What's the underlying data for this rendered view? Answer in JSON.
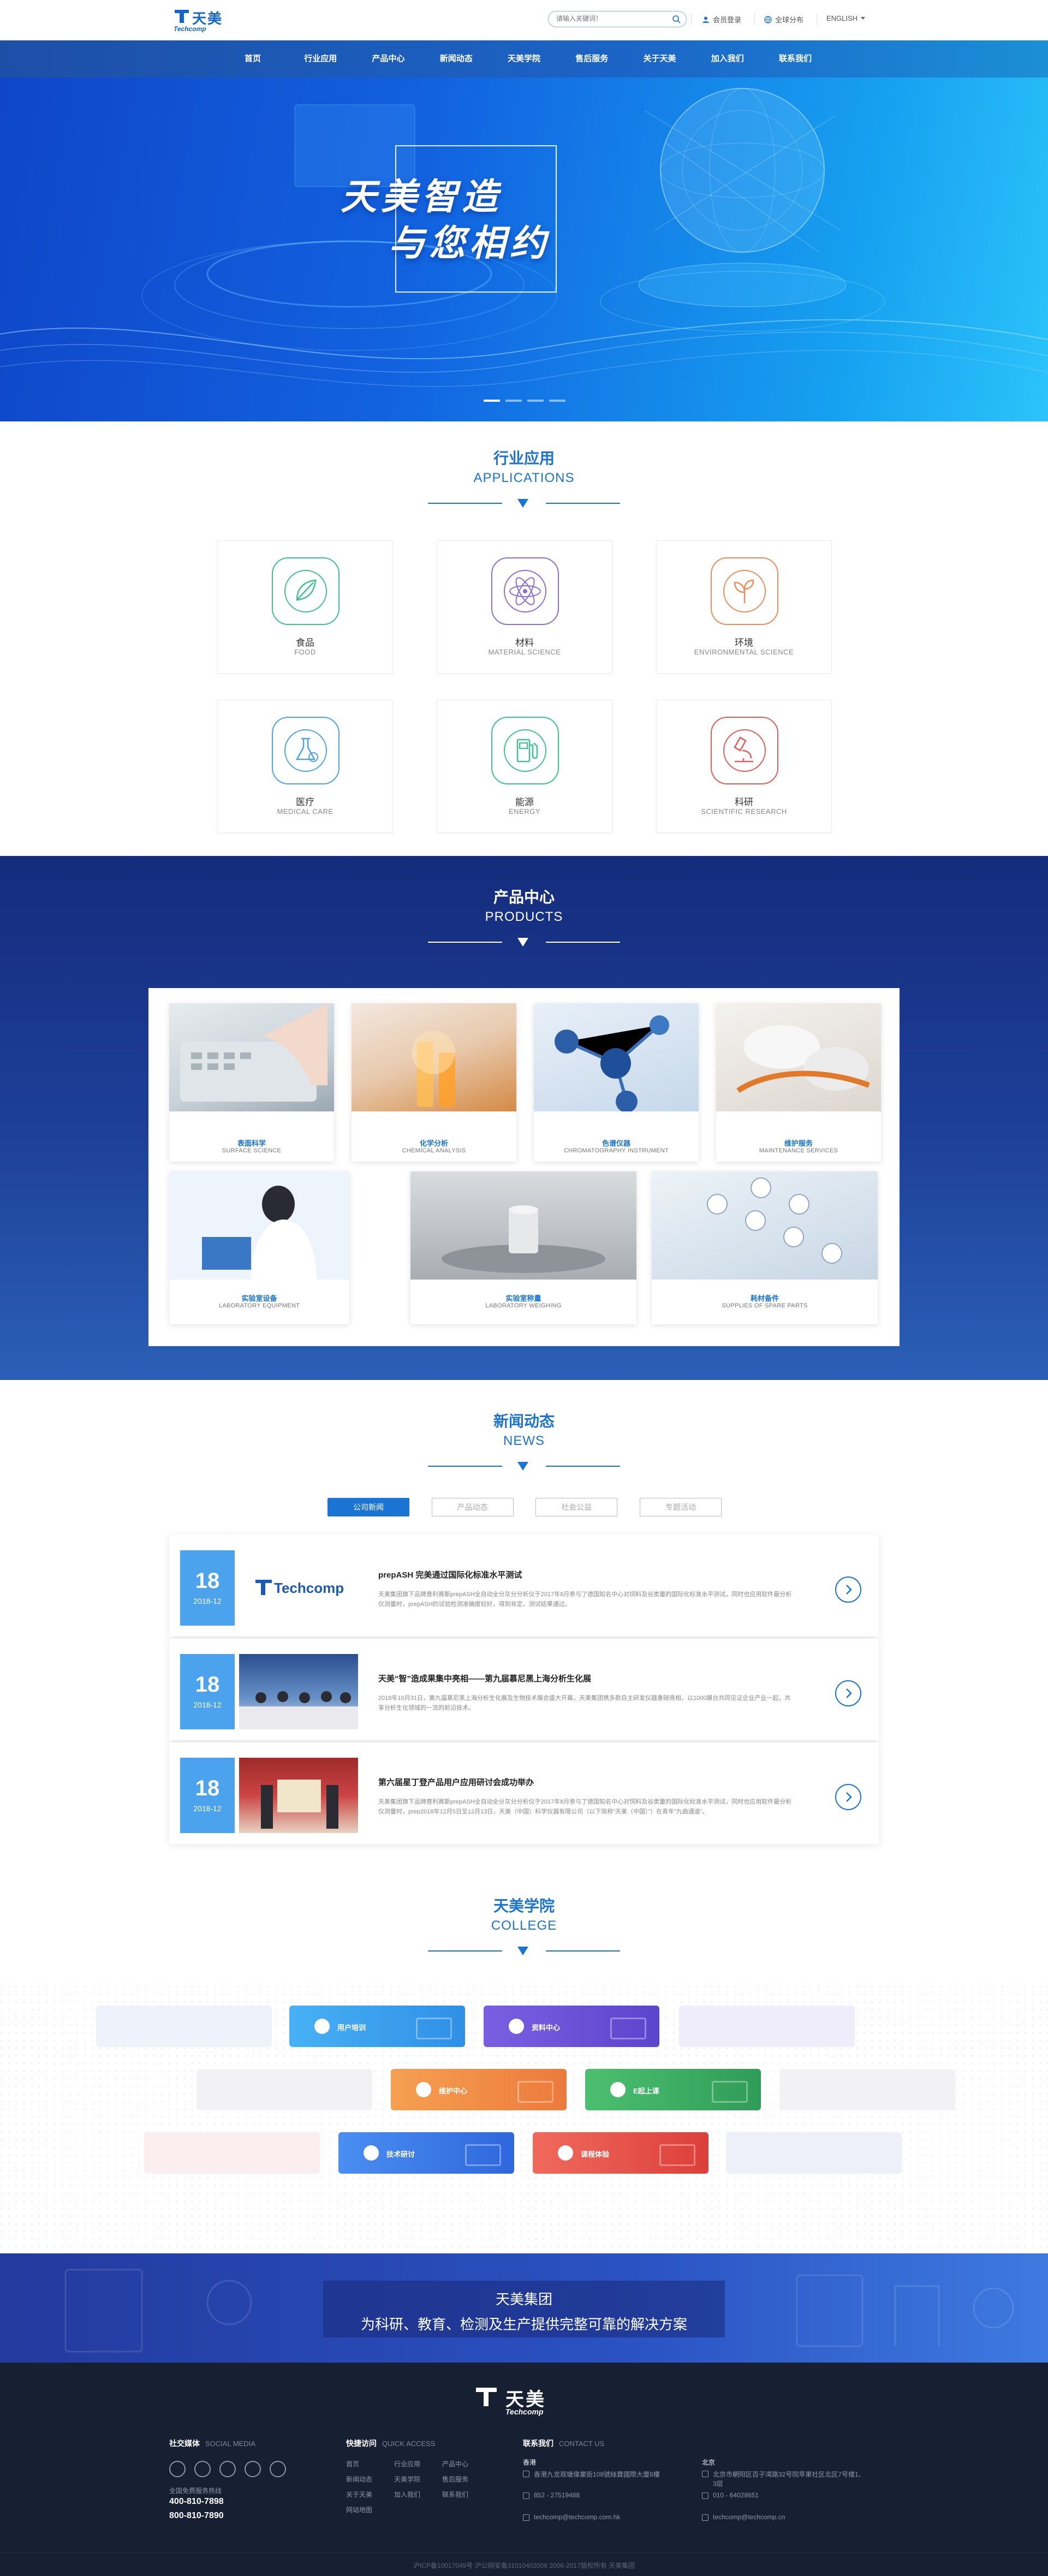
{
  "header": {
    "logo": {
      "cn": "天美",
      "en": "Techcomp"
    },
    "search": {
      "placeholder": "请输入关键词！"
    },
    "links": [
      "会员登录",
      "全球分布",
      "ENGLISH"
    ]
  },
  "nav": {
    "items": [
      "首页",
      "行业应用",
      "产品中心",
      "新闻动态",
      "天美学院",
      "售后服务",
      "关于天美",
      "加入我们",
      "联系我们"
    ]
  },
  "banner": {
    "line1": "天美智造",
    "line2": "与您相约",
    "dots": 4,
    "active": 0
  },
  "applications": {
    "title_cn": "行业应用",
    "title_en": "APPLICATIONS",
    "items": [
      {
        "cn": "食品",
        "en": "FOOD",
        "icon": "leaf-icon",
        "color": "#3cc28f"
      },
      {
        "cn": "材料",
        "en": "MATERIAL SCIENCE",
        "icon": "atom-icon",
        "color": "#8a70d6"
      },
      {
        "cn": "环境",
        "en": "ENVIRONMENTAL SCIENCE",
        "icon": "plant-icon",
        "color": "#f08c5a"
      },
      {
        "cn": "医疗",
        "en": "MEDICAL CARE",
        "icon": "flask-icon",
        "color": "#4aa3ec"
      },
      {
        "cn": "能源",
        "en": "ENERGY",
        "icon": "fuel-icon",
        "color": "#3cc28f"
      },
      {
        "cn": "科研",
        "en": "SCIENTIFIC RESEARCH",
        "icon": "microscope-icon",
        "color": "#e65a5a"
      }
    ]
  },
  "products": {
    "title_cn": "产品中心",
    "title_en": "PRODUCTS",
    "row1": [
      {
        "cn": "表面科学",
        "en": "SURFACE SCIENCE"
      },
      {
        "cn": "化学分析",
        "en": "CHEMICAL ANALYSIS"
      },
      {
        "cn": "色谱仪器",
        "en": "CHROMATOGRAPHY INSTRUMENT"
      },
      {
        "cn": "维护服务",
        "en": "MAINTENANCE SERVICES"
      }
    ],
    "row2": [
      {
        "cn": "实验室设备",
        "en": "LABORATORY EQUIPMENT"
      },
      {
        "cn": "实验室称量",
        "en": "LABORATORY WEIGHING"
      },
      {
        "cn": "耗材备件",
        "en": "SUPPLIES OF SPARE PARTS"
      }
    ]
  },
  "news": {
    "title_cn": "新闻动态",
    "title_en": "NEWS",
    "tabs": [
      "公司新闻",
      "产品动态",
      "社会公益",
      "专题活动"
    ],
    "active_tab": 0,
    "items": [
      {
        "day": "18",
        "month": "2018-12",
        "title": "prepASH 完美通过国际化标准水平测试",
        "desc": "天美集团旗下品牌普利赛斯prepASH全自动全分灰分分析仪于2017年8月参与了德国知名中心对饲料及谷类量的国际化标准水平测试，同时也应用软件最分析仪测量时，prepASH的试验检测准确度较好，得到肯定，测试结果通过。",
        "img": "Techcomp"
      },
      {
        "day": "18",
        "month": "2018-12",
        "title": "天美“智”造成果集中亮相——第九届慕尼黑上海分析生化展",
        "desc": "2018年10月31日，第九届慕尼黑上海分析生化展及生物技术展会盛大开幕，天美集团携多款自主研发仪器重磅亮相，以1000展台共同见证企业产业一起，共享分析生化领域的一流的前沿技术。"
      },
      {
        "day": "18",
        "month": "2018-12",
        "title": "第六届星丁登产品用户应用研讨会成功举办",
        "desc": "天美集团旗下品牌普利赛斯prepASH全自动全分灰分分析仪于2017年8月参与了德国知名中心对饲料及谷类量的国际化标准水平测试，同时也应用软件最分析仪测量时，prep2018年12月5日至12月13日，天美（中国）科学仪器有限公司（以下简称“天美（中国）”）在青年“九曲通道”。"
      }
    ]
  },
  "college": {
    "title_cn": "天美学院",
    "title_en": "COLLEGE",
    "buttons": [
      "用户培训",
      "资料中心",
      "维护中心",
      "E起上课",
      "技术研讨",
      "课程体验"
    ],
    "colors": [
      "#3c9ef0",
      "#6b55d8",
      "#f08a45",
      "#3aae62",
      "#3a7ae8",
      "#e8554e"
    ]
  },
  "slogan": {
    "line1": "天美集团",
    "line2": "为科研、教育、检测及生产提供完整可靠的解决方案"
  },
  "footer": {
    "logo": {
      "cn": "天美",
      "en": "Techcomp"
    },
    "social": {
      "title": "社交媒体",
      "sub": "SOCIAL MEDIA",
      "hotline_label": "全国免费服务热线",
      "phone1": "400-810-7898",
      "phone2": "800-810-7890"
    },
    "quick": {
      "title": "快捷访问",
      "sub": "QUICK ACCESS",
      "col1": [
        "首页",
        "新闻动态",
        "关于天美",
        "网站地图"
      ],
      "col2": [
        "行业应用",
        "天美学院",
        "加入我们"
      ],
      "col3": [
        "产品中心",
        "售后服务",
        "联系我们"
      ]
    },
    "contact": {
      "title": "联系我们",
      "sub": "CONTACT US",
      "hk": {
        "city": "香港",
        "addr": "香港九龙观塘偉業街108號絲寶國際大廈8樓",
        "tel": "852 - 27519488",
        "email": "techcomp@techcomp.com.hk"
      },
      "bj": {
        "city": "北京",
        "addr": "北京市朝阳区百子湾路32号院苹果社区北区7号楼1、3层",
        "tel": "010 - 64028651",
        "email": "techcomp@techcomp.cn"
      }
    },
    "copyright": "沪ICP备10017049号 沪公网安备31010402006  2006-2017版权所有 天美集团"
  }
}
